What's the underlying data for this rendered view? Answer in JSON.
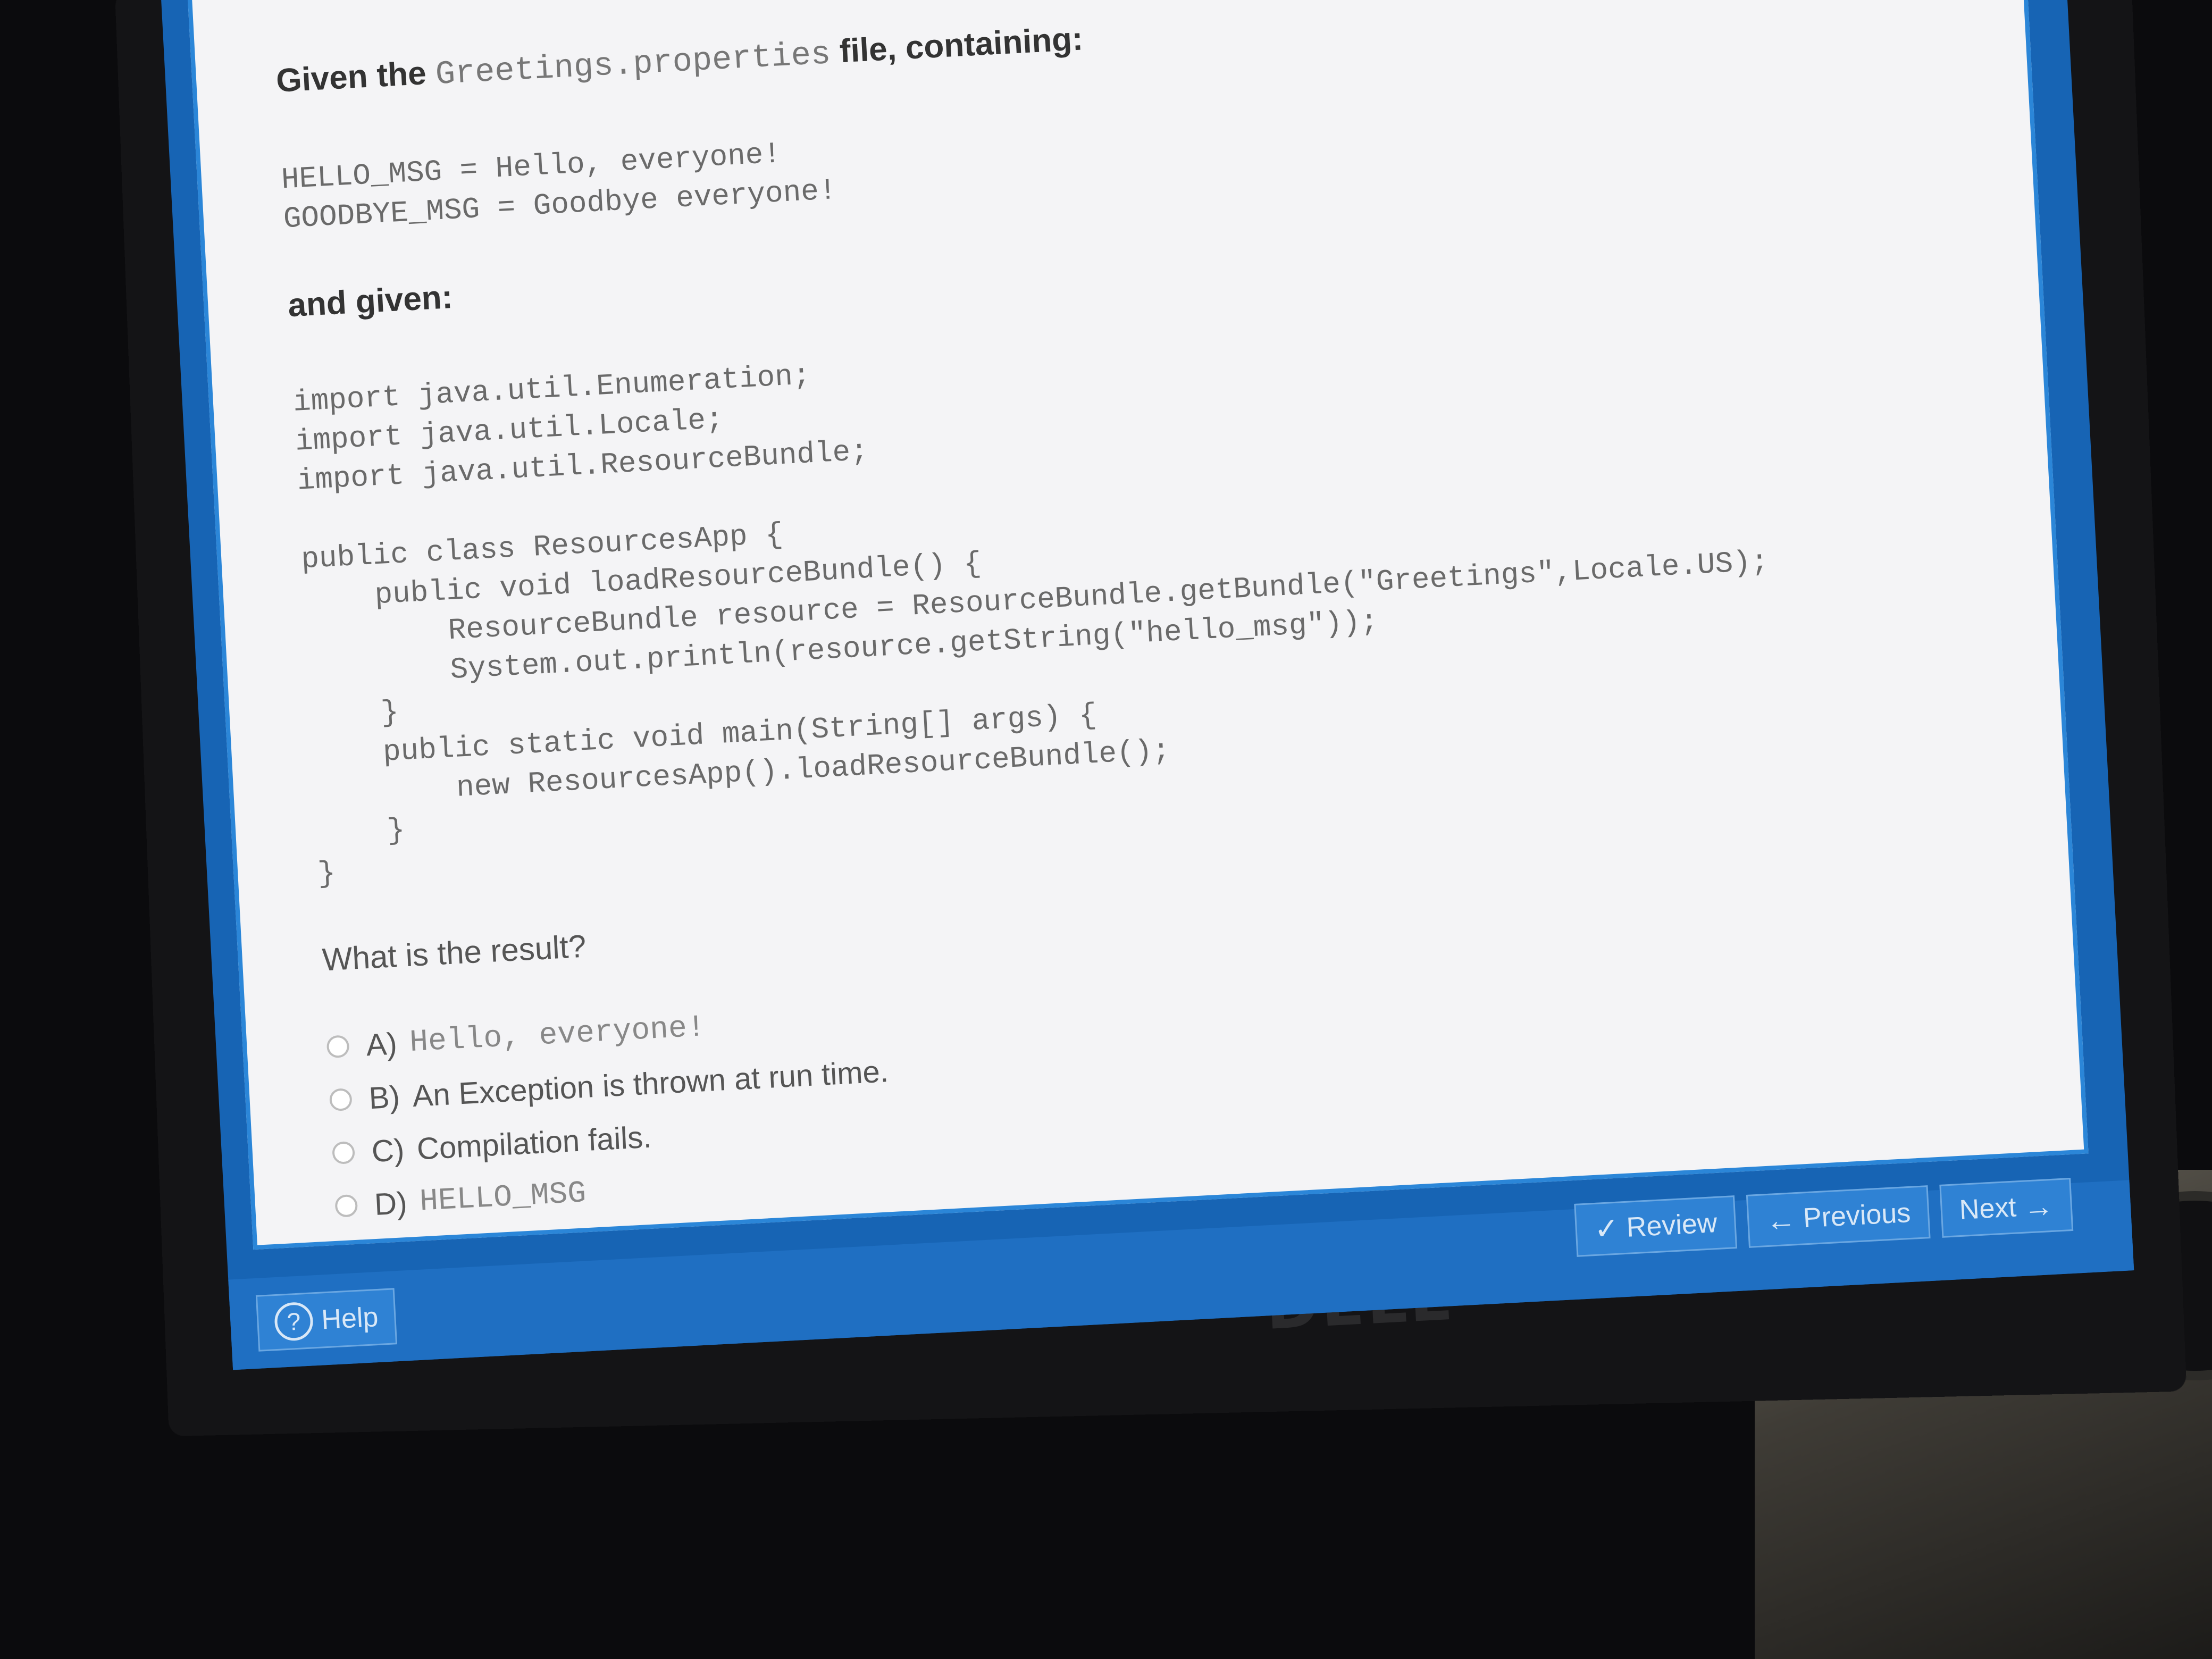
{
  "prompt": {
    "given_prefix": "Given the",
    "given_file": "Greetings.properties",
    "given_suffix": "file, containing:"
  },
  "properties_code": "HELLO_MSG = Hello, everyone!\nGOODBYE_MSG = Goodbye everyone!",
  "and_given": "and given:",
  "java_code": "import java.util.Enumeration;\nimport java.util.Locale;\nimport java.util.ResourceBundle;\n\npublic class ResourcesApp {\n    public void loadResourceBundle() {\n        ResourceBundle resource = ResourceBundle.getBundle(\"Greetings\",Locale.US);\n        System.out.println(resource.getString(\"hello_msg\"));\n    }\n    public static void main(String[] args) {\n        new ResourcesApp().loadResourceBundle();\n    }\n}",
  "question": "What is the result?",
  "options": [
    {
      "key": "A)",
      "text": "Hello, everyone!"
    },
    {
      "key": "B)",
      "text": "An Exception is thrown at run time."
    },
    {
      "key": "C)",
      "text": "Compilation fails."
    },
    {
      "key": "D)",
      "text": "HELLO_MSG"
    }
  ],
  "footer": {
    "help_label": "Help",
    "review_label": "Review",
    "previous_label": "Previous",
    "next_label": "Next"
  },
  "monitor_brand": "DELL",
  "colors": {
    "screen_background": "#f4f4f6",
    "frame_blue": "#1764b4",
    "button_blue": "#2f82d4"
  }
}
